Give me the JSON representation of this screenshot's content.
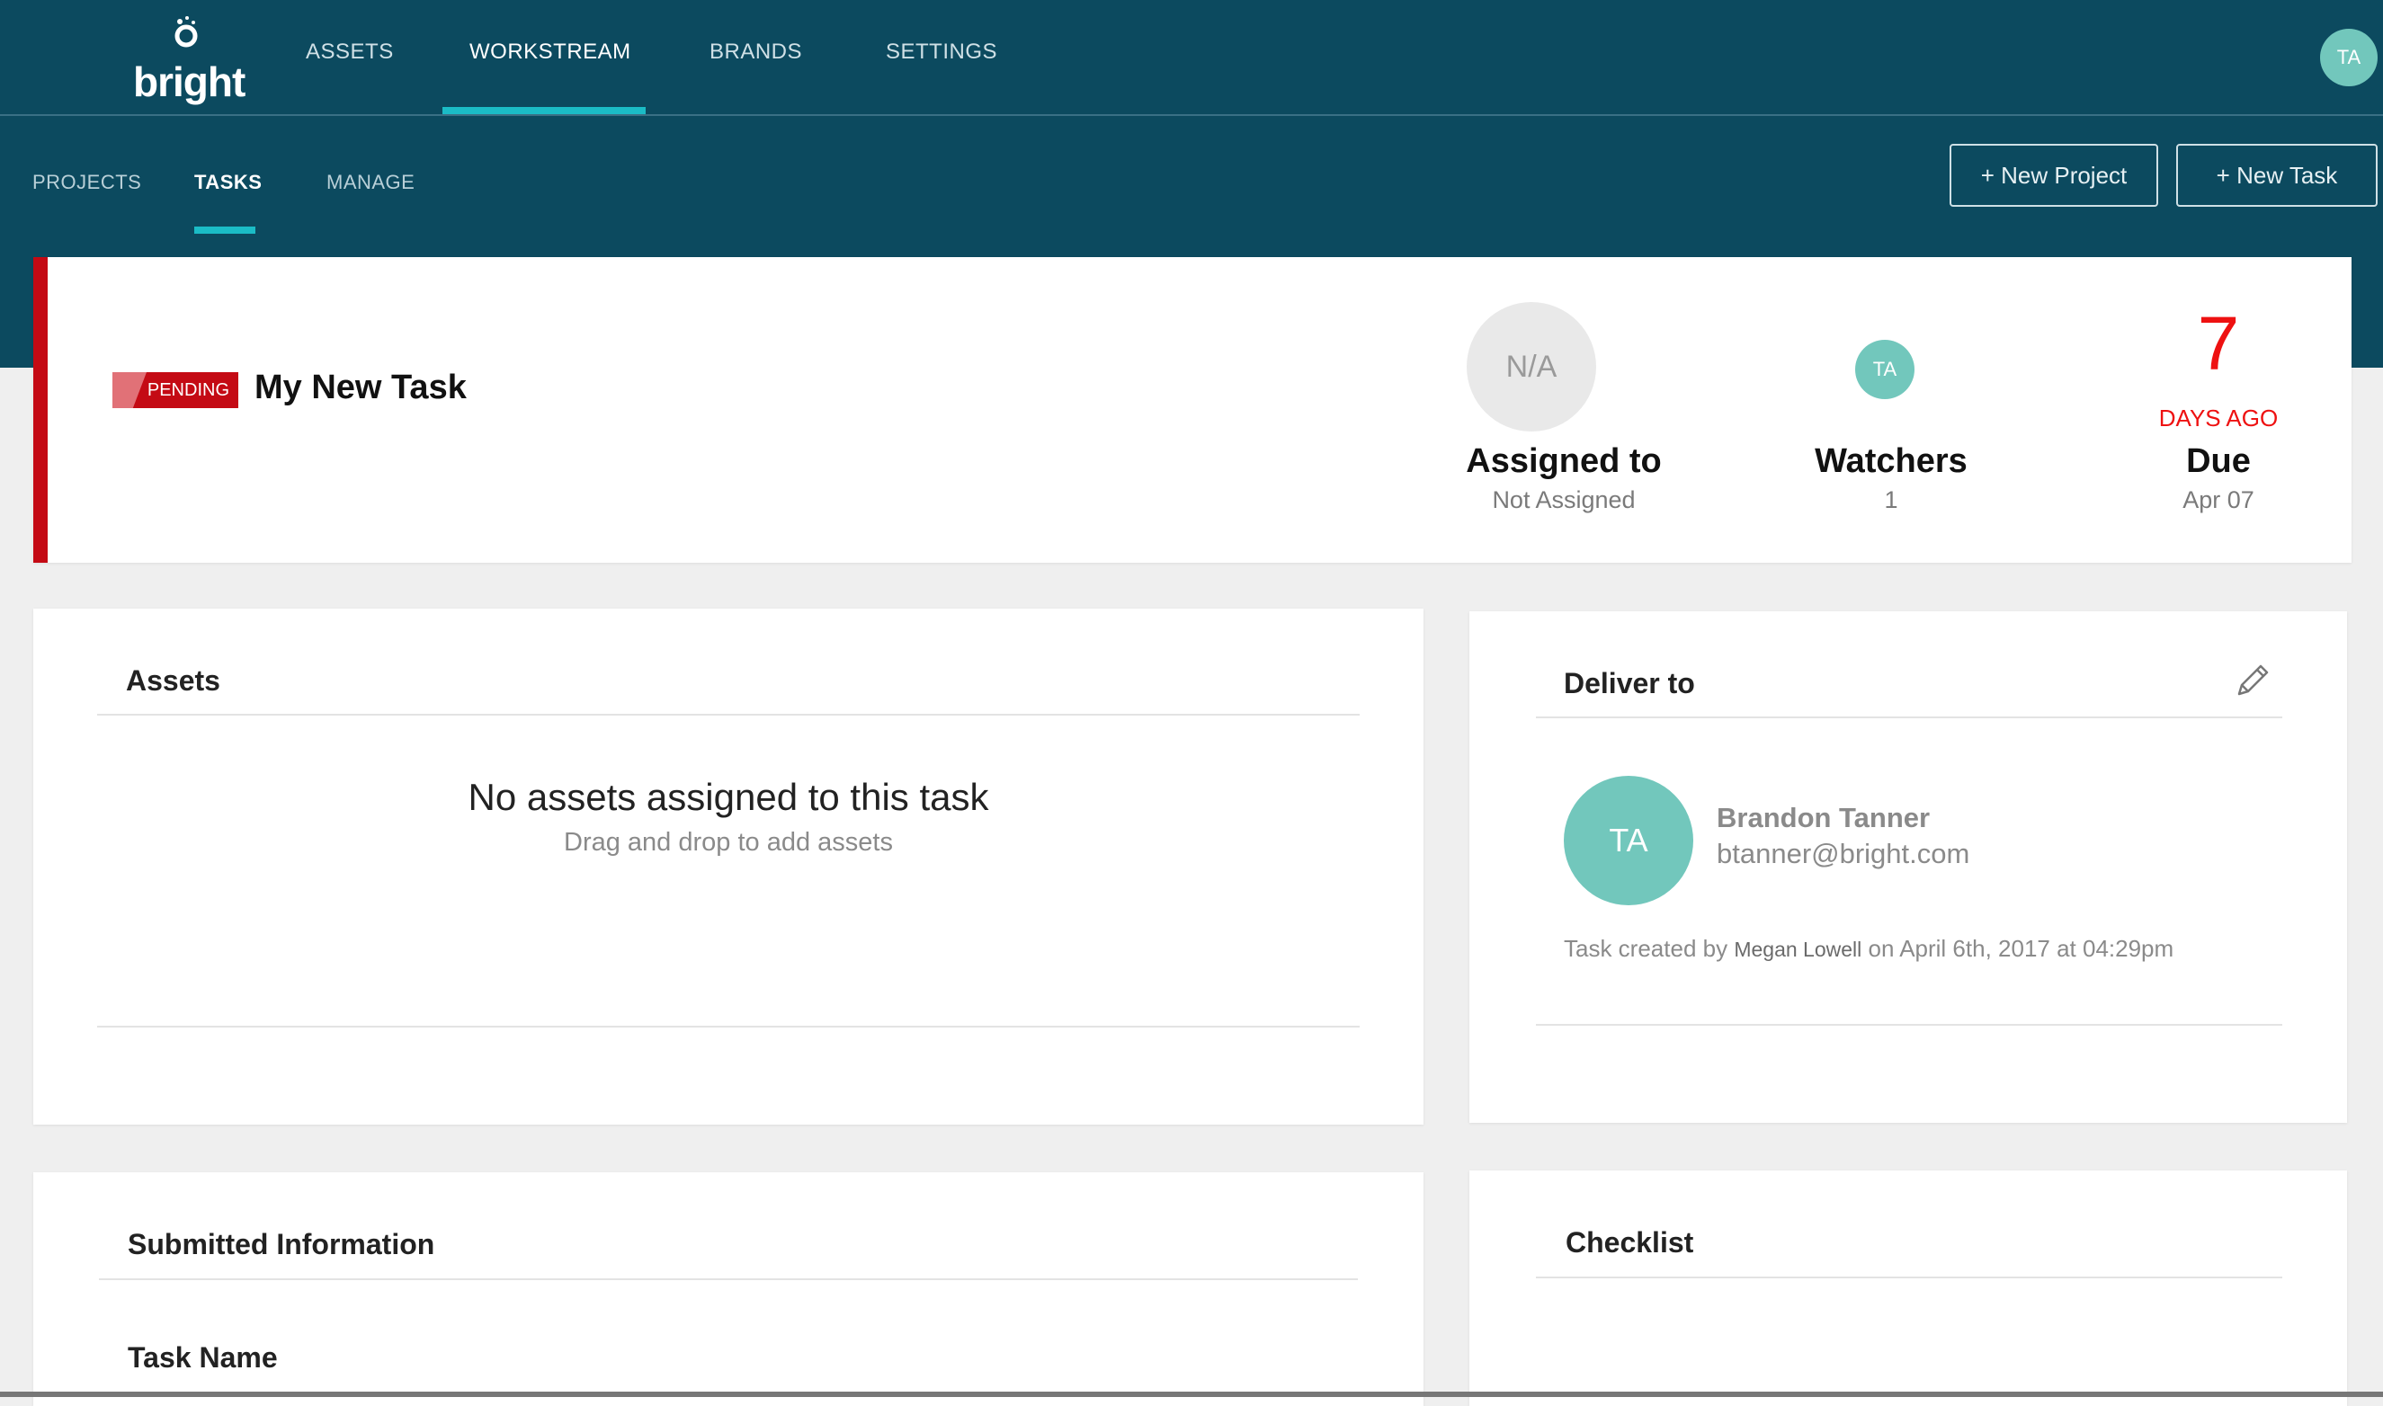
{
  "brand": {
    "logo_text": "bright"
  },
  "main_nav": [
    "ASSETS",
    "WORKSTREAM",
    "BRANDS",
    "SETTINGS"
  ],
  "user": {
    "initials": "TA"
  },
  "sub_nav": [
    "PROJECTS",
    "TASKS",
    "MANAGE"
  ],
  "actions": {
    "new_project": "+ New Project",
    "new_task": "+ New Task"
  },
  "task": {
    "status": "PENDING",
    "title": "My New Task",
    "assigned": {
      "avatar": "N/A",
      "label": "Assigned to",
      "value": "Not Assigned"
    },
    "watchers": {
      "avatar": "TA",
      "label": "Watchers",
      "count": "1"
    },
    "due": {
      "days": "7",
      "days_label": "DAYS AGO",
      "label": "Due",
      "date": "Apr 07"
    }
  },
  "assets": {
    "title": "Assets",
    "empty_title": "No assets assigned to this task",
    "empty_hint": "Drag and drop to add assets"
  },
  "deliver": {
    "title": "Deliver to",
    "avatar": "TA",
    "name": "Brandon Tanner",
    "email": "btanner@bright.com",
    "created_prefix": "Task created by",
    "created_by": "Megan Lowell",
    "created_suffix": "on April 6th, 2017 at 04:29pm"
  },
  "submitted": {
    "title": "Submitted Information",
    "field_label": "Task Name"
  },
  "checklist": {
    "title": "Checklist"
  },
  "colors": {
    "header": "#0c4a5f",
    "accent": "#1bbcc6",
    "pending": "#c40a14",
    "avatar": "#72c7bc",
    "overdue": "#ee1111"
  }
}
